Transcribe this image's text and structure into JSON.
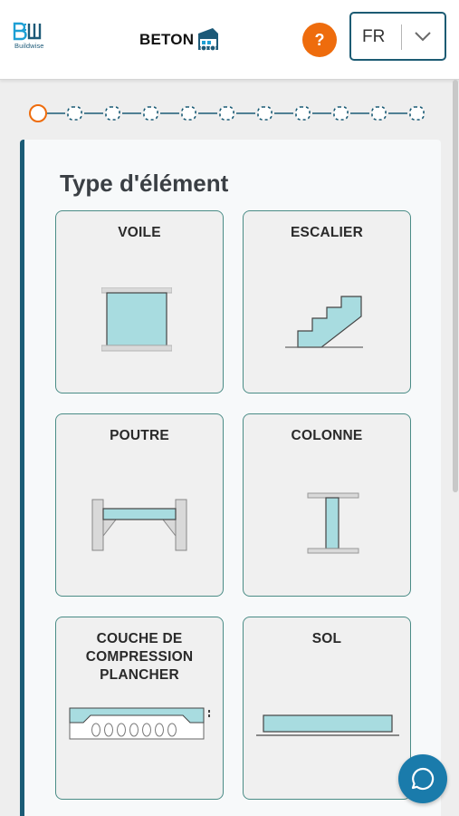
{
  "header": {
    "logo_text": "Buildwise",
    "app_name": "BETON",
    "help_label": "?",
    "language": {
      "selected": "FR"
    }
  },
  "progress": {
    "total_steps": 11,
    "current_step": 1
  },
  "main": {
    "title": "Type d'élément",
    "elements": [
      {
        "label": "VOILE",
        "icon": "wall-icon"
      },
      {
        "label": "ESCALIER",
        "icon": "staircase-icon"
      },
      {
        "label": "POUTRE",
        "icon": "beam-icon"
      },
      {
        "label": "COLONNE",
        "icon": "column-icon"
      },
      {
        "label": "COUCHE DE COMPRESSION PLANCHER",
        "icon": "floor-compression-layer-icon"
      },
      {
        "label": "SOL",
        "icon": "floor-slab-icon"
      }
    ]
  },
  "colors": {
    "accent_orange": "#ee6c0d",
    "brand_dark_teal": "#1b5c76",
    "tile_border": "#4a8c86",
    "concrete_fill": "#a8dce0",
    "chat_button": "#1a7bab"
  }
}
